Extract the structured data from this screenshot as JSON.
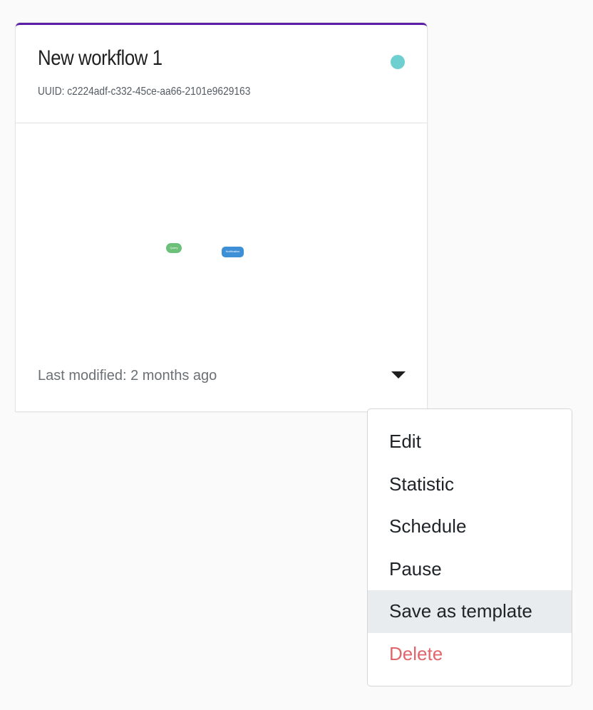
{
  "card": {
    "title": "New workflow 1",
    "uuid_text": "UUID: c2224adf-c332-45ce-aa66-2101e9629163",
    "status_color": "#6ecfd1",
    "accent_color": "#5b1fa6",
    "last_modified": "Last modified: 2 months ago",
    "preview_nodes": [
      {
        "label": "Query",
        "color": "#6cc07a"
      },
      {
        "label": "Notification",
        "color": "#3d8fd6"
      }
    ]
  },
  "menu": {
    "items": [
      {
        "label": "Edit"
      },
      {
        "label": "Statistic"
      },
      {
        "label": "Schedule"
      },
      {
        "label": "Pause"
      },
      {
        "label": "Save as template",
        "state": "hovered"
      },
      {
        "label": "Delete",
        "style": "danger",
        "color": "#e0666b"
      }
    ]
  }
}
